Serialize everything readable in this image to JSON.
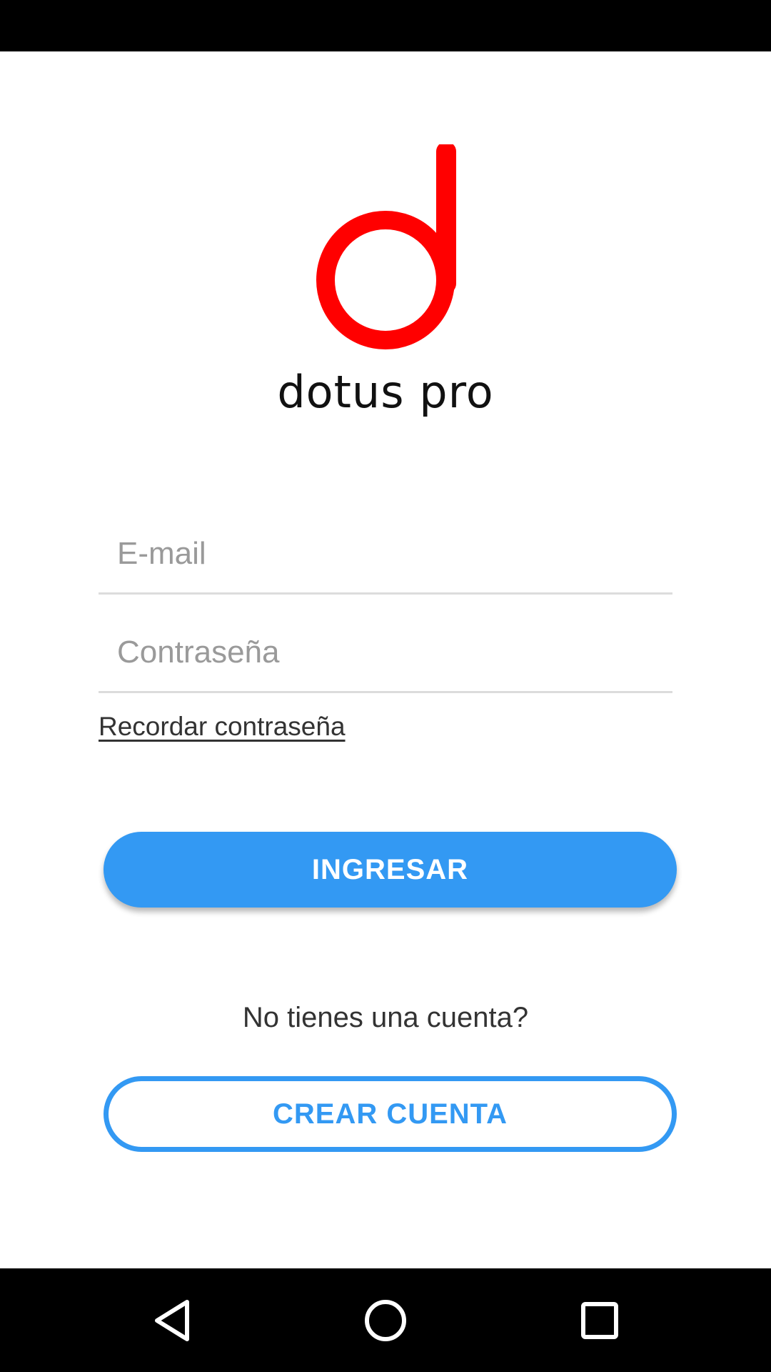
{
  "app": {
    "brand_name": "dotus pro",
    "logo_icon": "dotus-d-logo",
    "accent_color": "#3399f3",
    "logo_color": "#ff0000"
  },
  "login_form": {
    "email_placeholder": "E-mail",
    "password_placeholder": "Contraseña",
    "forgot_password_label": "Recordar contraseña",
    "login_button_label": "INGRESAR"
  },
  "signup": {
    "prompt": "No tienes una cuenta?",
    "create_button_label": "CREAR CUENTA"
  },
  "navigation_bar": {
    "back_icon": "back-triangle-icon",
    "home_icon": "home-circle-icon",
    "recent_icon": "recent-apps-square-icon"
  }
}
